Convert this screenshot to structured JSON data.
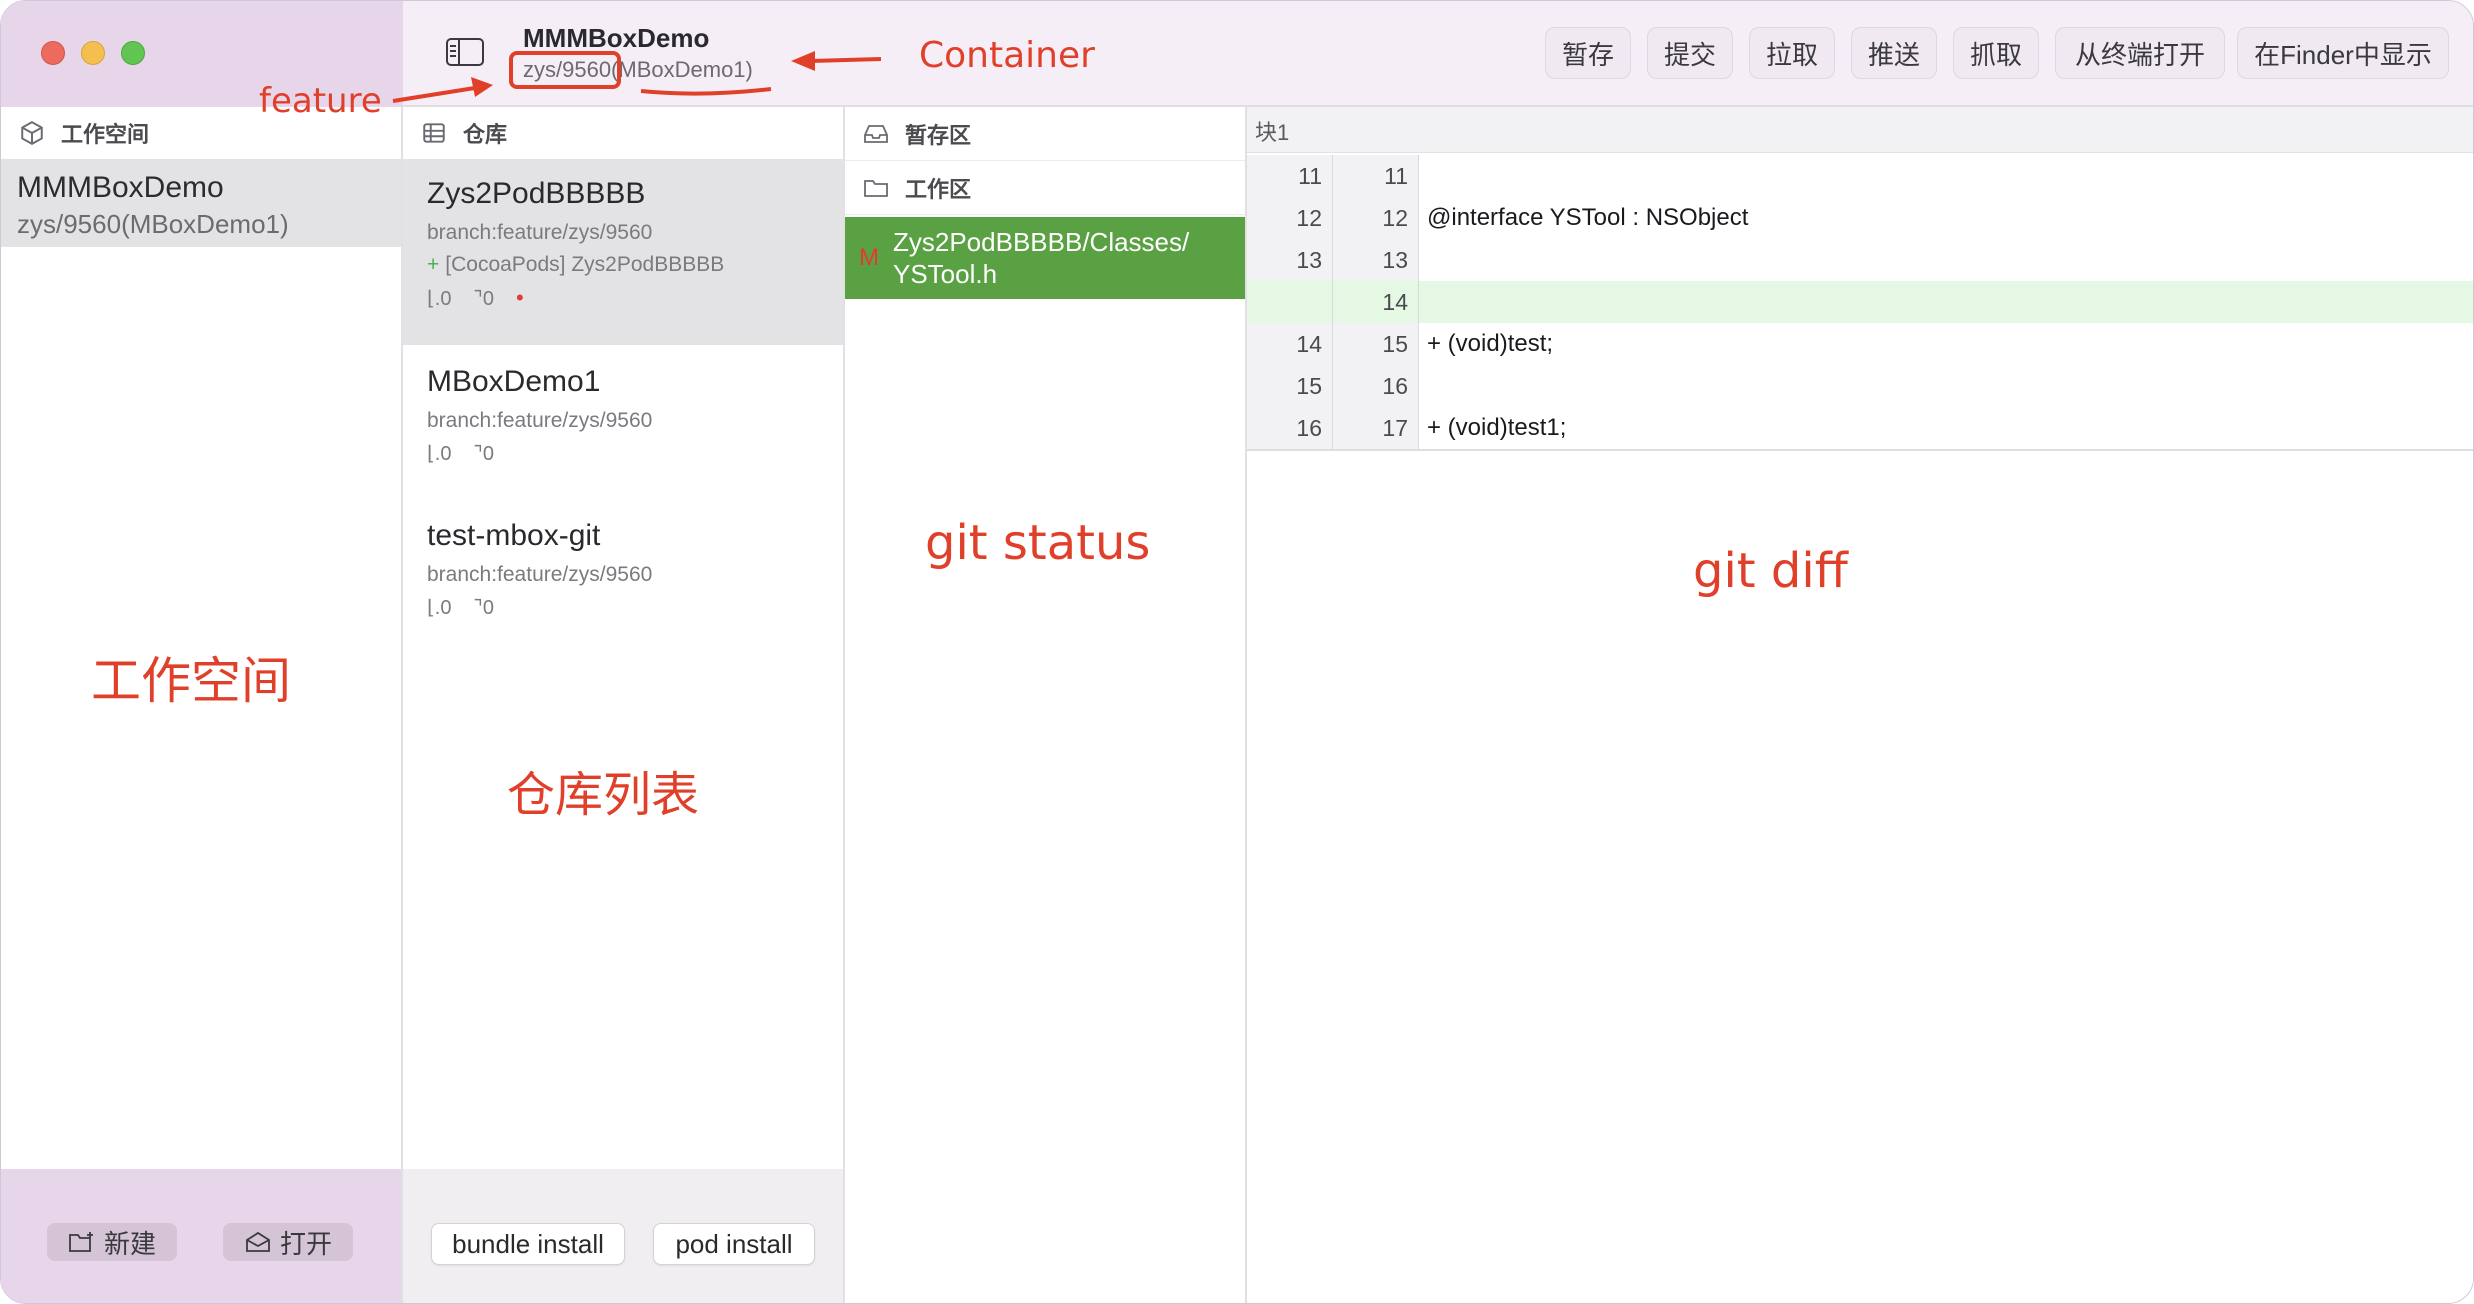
{
  "window": {
    "title": "MMMBoxDemo",
    "subtitle": "zys/9560(MBoxDemo1)"
  },
  "toolbar": {
    "buttons": [
      "暂存",
      "提交",
      "拉取",
      "推送",
      "抓取",
      "从终端打开",
      "在Finder中显示"
    ]
  },
  "workspace": {
    "header": "工作空间",
    "item": {
      "name": "MMMBoxDemo",
      "sub": "zys/9560(MBoxDemo1)"
    },
    "new_label": "新建",
    "open_label": "打开"
  },
  "repos": {
    "header": "仓库",
    "items": [
      {
        "name": "Zys2PodBBBBB",
        "branch": "branch:feature/zys/9560",
        "pod": "[CocoaPods]  Zys2PodBBBBB",
        "pod_sign": "+",
        "down": "⌊.0",
        "up": "⌝0",
        "dot": "•"
      },
      {
        "name": "MBoxDemo1",
        "branch": "branch:feature/zys/9560",
        "down": "⌊.0",
        "up": "⌝0"
      },
      {
        "name": "test-mbox-git",
        "branch": "branch:feature/zys/9560",
        "down": "⌊.0",
        "up": "⌝0"
      }
    ],
    "bundle_install": "bundle install",
    "pod_install": "pod install"
  },
  "status": {
    "staged": "暂存区",
    "working": "工作区",
    "file_flag": "M",
    "file_path": "Zys2PodBBBBB/Classes/\nYSTool.h"
  },
  "diff": {
    "hunk": "块1",
    "rows": [
      {
        "a": "11",
        "b": "11",
        "code": "",
        "added": false
      },
      {
        "a": "12",
        "b": "12",
        "code": "@interface YSTool : NSObject",
        "added": false
      },
      {
        "a": "13",
        "b": "13",
        "code": "",
        "added": false
      },
      {
        "a": "",
        "b": "14",
        "code": "",
        "added": true
      },
      {
        "a": "14",
        "b": "15",
        "code": "+ (void)test;",
        "added": false
      },
      {
        "a": "15",
        "b": "16",
        "code": "",
        "added": false
      },
      {
        "a": "16",
        "b": "17",
        "code": "+ (void)test1;",
        "added": false
      }
    ]
  },
  "annotations": {
    "feature": "feature",
    "container": "Container",
    "workspace": "工作空间",
    "repo_list": "仓库列表",
    "git_status": "git status",
    "git_diff": "git diff",
    "color": "#e0402a"
  }
}
